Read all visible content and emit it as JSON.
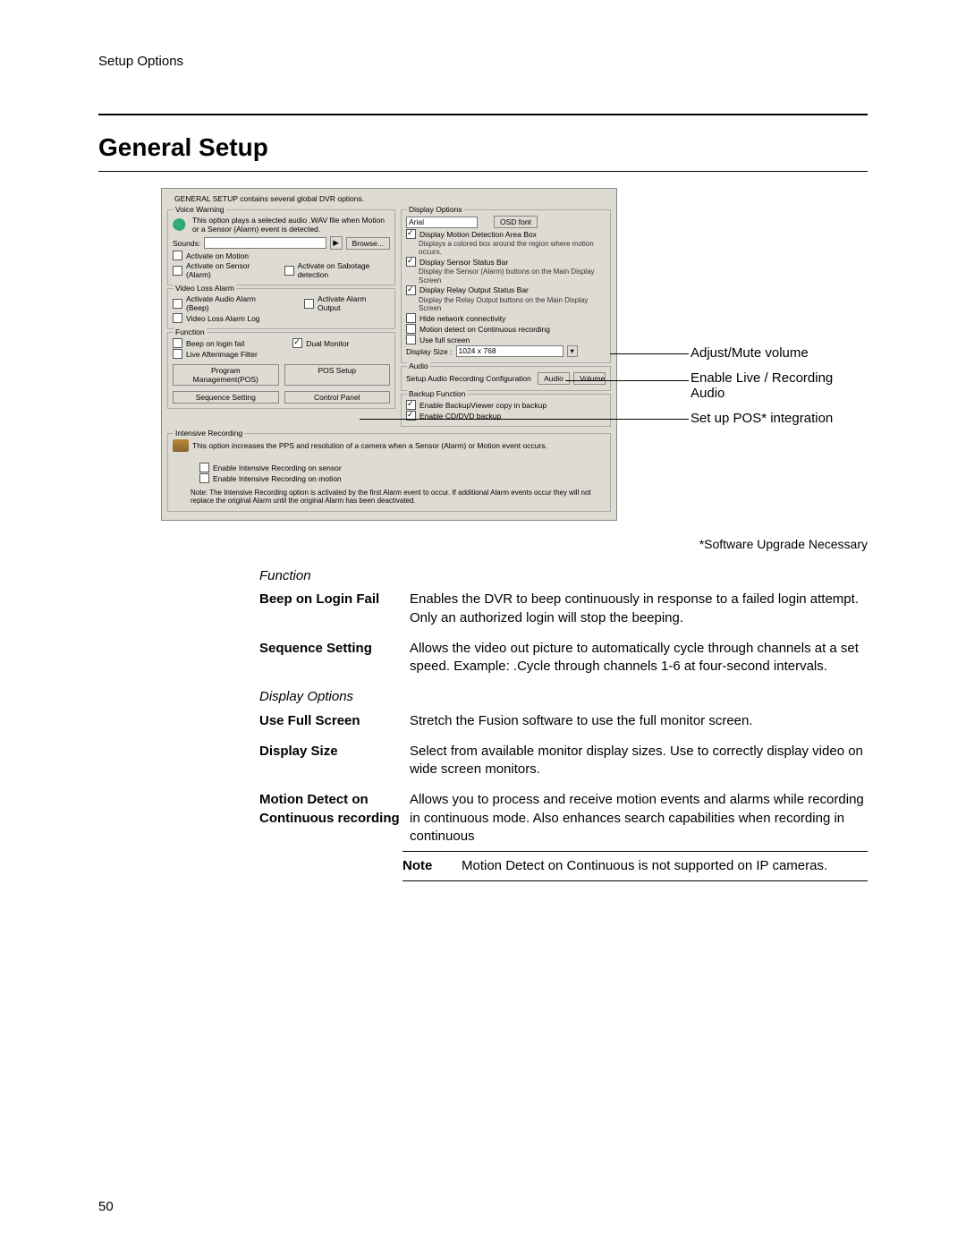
{
  "header": {
    "section": "Setup Options"
  },
  "title": "General Setup",
  "screenshot": {
    "intro": "GENERAL SETUP contains several global DVR options.",
    "voice_warning": {
      "legend": "Voice Warning",
      "note": "This option plays a selected audio .WAV file when Motion or a Sensor (Alarm) event is detected.",
      "sounds_label": "Sounds:",
      "play_label": "▶",
      "browse_label": "Browse...",
      "cb_activate_motion": "Activate on Motion",
      "cb_activate_sensor": "Activate on Sensor (Alarm)",
      "cb_activate_sabotage": "Activate on Sabotage detection"
    },
    "video_loss": {
      "legend": "Video Loss Alarm",
      "cb_audio_beep": "Activate Audio Alarm (Beep)",
      "cb_alarm_output": "Activate Alarm Output",
      "cb_log": "Video Loss Alarm Log"
    },
    "function": {
      "legend": "Function",
      "cb_beep_login": "Beep on login fail",
      "cb_dual_monitor": "Dual Monitor",
      "cb_afterimage": "Live Afterimage Filter",
      "btn_program_pos": "Program Management(POS)",
      "btn_pos_setup": "POS Setup",
      "btn_sequence": "Sequence Setting",
      "btn_control_panel": "Control Panel"
    },
    "display_options": {
      "legend": "Display Options",
      "font_value": "Arial",
      "btn_osd": "OSD font",
      "cb_motion_box": "Display Motion Detection Area Box",
      "motion_box_sub": "Displays a colored box around the region where motion occurs.",
      "cb_sensor_bar": "Display Sensor Status Bar",
      "sensor_bar_sub": "Display the Sensor (Alarm) buttons on the Main Display Screen",
      "cb_relay_bar": "Display Relay Output Status Bar",
      "relay_bar_sub": "Display the Relay Output buttons on the Main Display Screen",
      "cb_hide_net": "Hide network connectivity",
      "cb_motion_cont": "Motion detect on Continuous recording",
      "cb_use_full": "Use full screen",
      "size_label": "Display Size :",
      "size_value": "1024 x 768"
    },
    "audio": {
      "legend": "Audio",
      "text": "Setup Audio Recording Configuration",
      "btn_audio": "Audio",
      "btn_volume": "Volume"
    },
    "backup": {
      "legend": "Backup Function",
      "cb_viewer": "Enable BackupViewer copy in backup",
      "cb_cddvd": "Enable CD/DVD backup"
    },
    "intensive": {
      "legend": "Intensive Recording",
      "note": "This option increases the PPS and resolution of a camera when a Sensor (Alarm) or Motion event occurs.",
      "cb_sensor": "Enable Intensive Recording on sensor",
      "cb_motion": "Enable Intensive Recording on motion",
      "footnote": "Note: The Intensive Recording option is activated by the first Alarm event to occur. If additional Alarm events occur they will not replace the original Alarm until the original Alarm has been deactivated."
    }
  },
  "callouts": {
    "c1": "Adjust/Mute volume",
    "c2": "Enable Live / Recording Audio",
    "c3": "Set up POS* integration"
  },
  "footnote": "*Software Upgrade Necessary",
  "desc": {
    "function_head": "Function",
    "rows_function": [
      {
        "term": "Beep on Login Fail",
        "def": "Enables the DVR to beep continuously in response to a failed login attempt.  Only an authorized login will stop the beeping."
      },
      {
        "term": "Sequence Setting",
        "def": "Allows the video out picture to automatically cycle through channels at a set speed.  Example: .Cycle through channels 1-6 at four-second intervals."
      }
    ],
    "display_head": "Display Options",
    "rows_display": [
      {
        "term": "Use Full Screen",
        "def": "Stretch the Fusion software to use the full monitor screen."
      },
      {
        "term": "Display Size",
        "def": "Select from available monitor display sizes.  Use to correctly display video on wide screen monitors."
      },
      {
        "term": "Motion Detect on Continuous recording",
        "def": "Allows you to process and receive motion events and alarms while recording in continuous mode. Also enhances search capabilities when recording in continuous"
      }
    ],
    "note_label": "Note",
    "note_text": "Motion Detect on Continuous is not supported on IP cameras."
  },
  "page_number": "50"
}
